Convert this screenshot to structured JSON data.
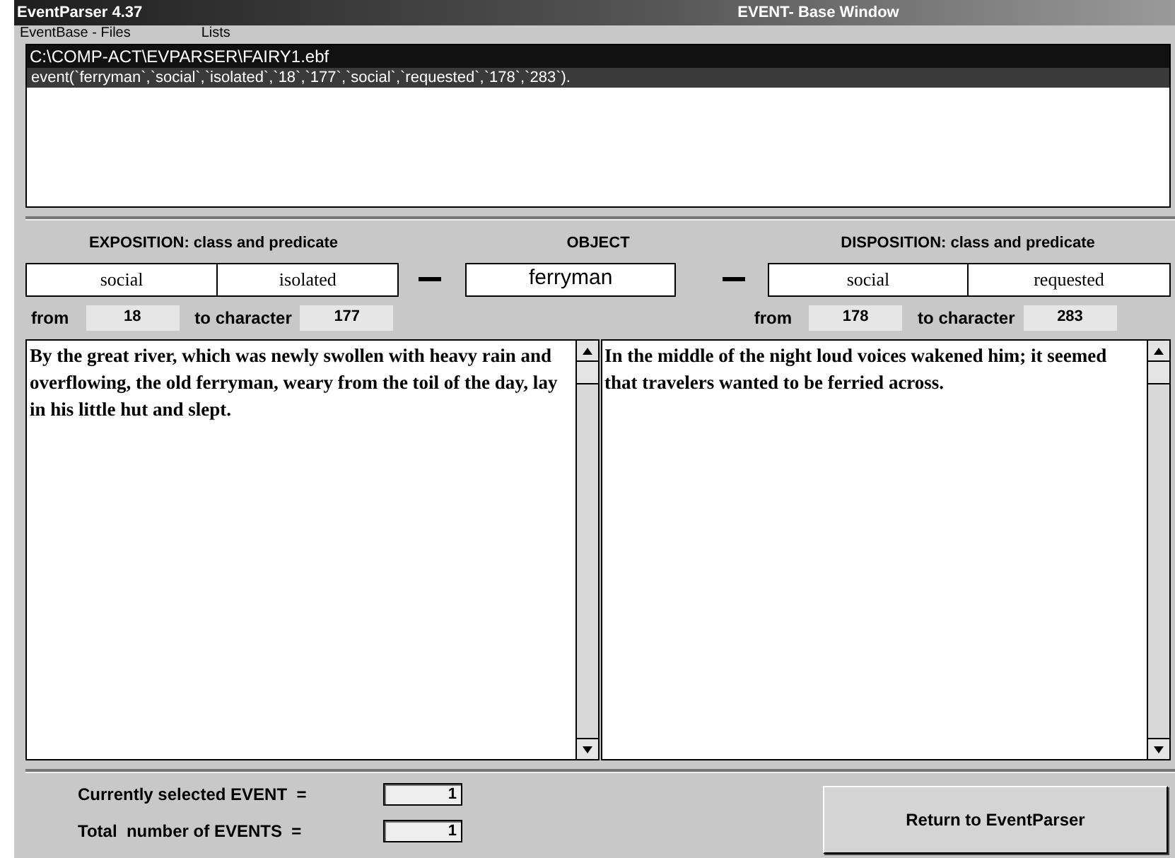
{
  "window": {
    "title": "EventParser 4.37",
    "subtitle": "EVENT- Base Window"
  },
  "menu": [
    {
      "label": "EventBase - Files"
    },
    {
      "label": "Lists"
    }
  ],
  "file_list": [
    {
      "kind": "path",
      "text": "C:\\COMP-ACT\\EVPARSER\\FAIRY1.ebf",
      "selected": false
    },
    {
      "kind": "event",
      "text": "event(`ferryman`,`social`,`isolated`,`18`,`177`,`social`,`requested`,`178`,`283`).",
      "selected": true
    }
  ],
  "exposition": {
    "heading": "EXPOSITION:  class and predicate",
    "class": "social",
    "predicate": "isolated",
    "from_label": "from",
    "from": "18",
    "to_label": "to character",
    "to": "177",
    "text": "By the great river, which was newly swollen with heavy rain and overflowing, the old ferryman, weary from the toil of the day, lay in his little hut and slept."
  },
  "object": {
    "heading": "OBJECT",
    "value": "ferryman"
  },
  "disposition": {
    "heading": "DISPOSITION:  class and predicate",
    "class": "social",
    "predicate": "requested",
    "from_label": "from",
    "from": "178",
    "to_label": "to character",
    "to": "283",
    "text": "In the middle of the night loud voices wakened him; it seemed that travelers wanted to be ferried across."
  },
  "counters": [
    {
      "label": "Currently selected EVENT  =",
      "value": "1"
    },
    {
      "label": "Total  number of EVENTS  =",
      "value": "1"
    }
  ],
  "return_button": "Return to EventParser"
}
